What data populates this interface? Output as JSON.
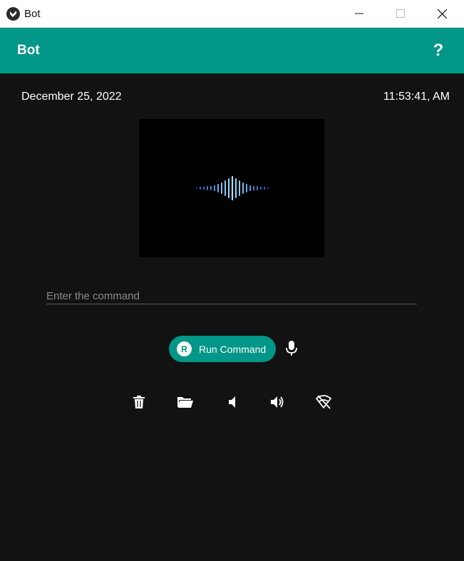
{
  "window": {
    "title": "Bot",
    "controls": {
      "minimize": "minimize",
      "maximize": "maximize",
      "close": "close"
    }
  },
  "appbar": {
    "title": "Bot",
    "help_label": "?",
    "color": "#009688"
  },
  "status": {
    "date": "December 25, 2022",
    "time": "11:53:41, AM"
  },
  "visualizer": {
    "icon": "sound-wave",
    "colors": [
      "#8fd3ff",
      "#3a7bd5"
    ]
  },
  "command": {
    "placeholder": "Enter the command",
    "value": ""
  },
  "run_button": {
    "icon_letter": "R",
    "label": "Run Command"
  },
  "icons": {
    "mic": "microphone-icon",
    "toolbar": [
      "trash-icon",
      "folder-open-icon",
      "volume-mute-icon",
      "volume-up-icon",
      "wifi-off-icon"
    ]
  }
}
